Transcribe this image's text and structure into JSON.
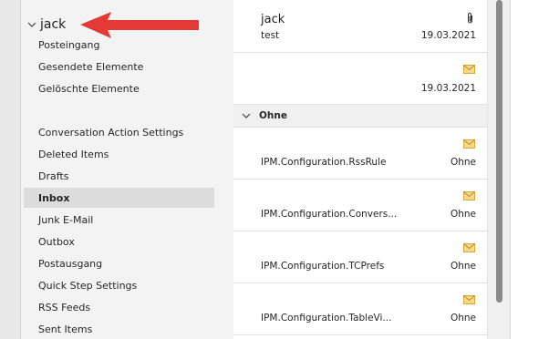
{
  "account": {
    "name": "jack"
  },
  "folders": [
    {
      "label": "Posteingang"
    },
    {
      "label": "Gesendete Elemente"
    },
    {
      "label": "Gelöschte Elemente"
    },
    {
      "label": "Conversation Action Settings"
    },
    {
      "label": "Deleted Items"
    },
    {
      "label": "Drafts"
    },
    {
      "label": "Inbox",
      "selected": true
    },
    {
      "label": "Junk E-Mail"
    },
    {
      "label": "Outbox"
    },
    {
      "label": "Postausgang"
    },
    {
      "label": "Quick Step Settings"
    },
    {
      "label": "RSS Feeds"
    },
    {
      "label": "Sent Items"
    }
  ],
  "messages_top": [
    {
      "sender": "jack",
      "subject": "test",
      "date": "19.03.2021",
      "icon": "paperclip-icon"
    },
    {
      "sender": "",
      "subject": "",
      "date": "19.03.2021",
      "icon": "envelope-icon"
    }
  ],
  "group": {
    "label": "Ohne"
  },
  "messages_group": [
    {
      "subject": "IPM.Configuration.RssRule",
      "category": "Ohne",
      "icon": "envelope-icon"
    },
    {
      "subject": "IPM.Configuration.Convers...",
      "category": "Ohne",
      "icon": "envelope-icon"
    },
    {
      "subject": "IPM.Configuration.TCPrefs",
      "category": "Ohne",
      "icon": "envelope-icon"
    },
    {
      "subject": "IPM.Configuration.TableVi...",
      "category": "Ohne",
      "icon": "envelope-icon"
    }
  ],
  "colors": {
    "arrow": "#e53935",
    "envelope": "#e6b84a",
    "selected": "#dcdcdc"
  }
}
